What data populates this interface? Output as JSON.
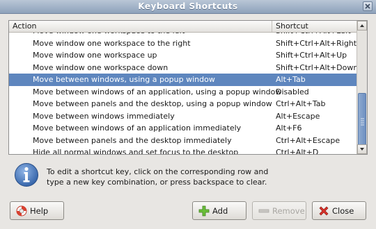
{
  "window": {
    "title": "Keyboard Shortcuts"
  },
  "table": {
    "headers": {
      "action": "Action",
      "shortcut": "Shortcut"
    },
    "rows": [
      {
        "action": "Move window one workspace to the left",
        "shortcut": "Shift+Ctrl+Alt+Left"
      },
      {
        "action": "Move window one workspace to the right",
        "shortcut": "Shift+Ctrl+Alt+Right"
      },
      {
        "action": "Move window one workspace up",
        "shortcut": "Shift+Ctrl+Alt+Up"
      },
      {
        "action": "Move window one workspace down",
        "shortcut": "Shift+Ctrl+Alt+Down"
      },
      {
        "action": "Move between windows, using a popup window",
        "shortcut": "Alt+Tab",
        "selected": true
      },
      {
        "action": "Move between windows of an application, using a popup window",
        "shortcut": "Disabled"
      },
      {
        "action": "Move between panels and the desktop, using a popup window",
        "shortcut": "Ctrl+Alt+Tab"
      },
      {
        "action": "Move between windows immediately",
        "shortcut": "Alt+Escape"
      },
      {
        "action": "Move between windows of an application immediately",
        "shortcut": "Alt+F6"
      },
      {
        "action": "Move between panels and the desktop immediately",
        "shortcut": "Ctrl+Alt+Escape"
      },
      {
        "action": "Hide all normal windows and set focus to the desktop",
        "shortcut": "Ctrl+Alt+D"
      }
    ]
  },
  "info": {
    "icon": "info-icon",
    "line1": "To edit a shortcut key, click on the corresponding row and",
    "line2": "type a new key combination, or press backspace to clear."
  },
  "buttons": {
    "help": "Help",
    "add": "Add",
    "remove": "Remove",
    "close": "Close"
  },
  "colors": {
    "selection": "#5e86be",
    "titlebar": "#8ea2bb"
  }
}
